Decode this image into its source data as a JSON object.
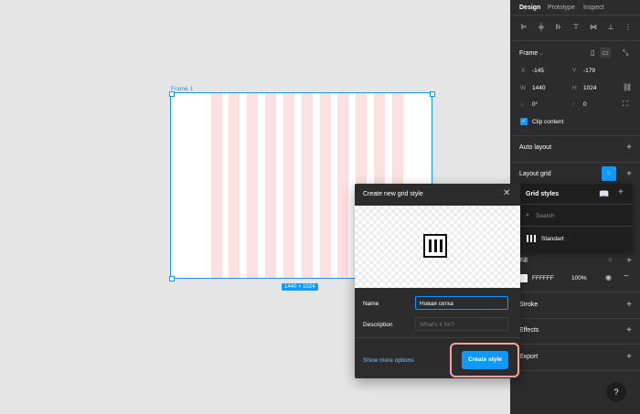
{
  "canvas": {
    "frame_name": "Frame 1",
    "frame_size": "1440 × 1024",
    "grid_color": "#fde0e0"
  },
  "panel": {
    "tabs": [
      "Design",
      "Prototype",
      "Inspect"
    ],
    "frame_section": "Frame",
    "x_label": "X",
    "x_value": "-145",
    "y_label": "Y",
    "y_value": "-179",
    "w_label": "W",
    "w_value": "1440",
    "h_label": "H",
    "h_value": "1024",
    "rotation": "0°",
    "radius": "0",
    "clip_content": "Clip content",
    "auto_layout": "Auto layout",
    "layout_grid": "Layout grid",
    "fill": "Fill",
    "fill_hex": "FFFFFF",
    "fill_opacity": "100%",
    "stroke": "Stroke",
    "effects": "Effects",
    "export": "Export",
    "help": "?"
  },
  "grid_styles": {
    "title": "Grid styles",
    "search_placeholder": "Search",
    "items": [
      "Standart"
    ]
  },
  "dialog": {
    "title": "Create new grid style",
    "name_label": "Name",
    "name_value": "Новая сетка",
    "description_label": "Description",
    "description_placeholder": "What's it for?",
    "show_more": "Show more options",
    "create_button": "Create style"
  },
  "colors": {
    "accent": "#0d99ff",
    "highlight": "#f4a3a3"
  }
}
